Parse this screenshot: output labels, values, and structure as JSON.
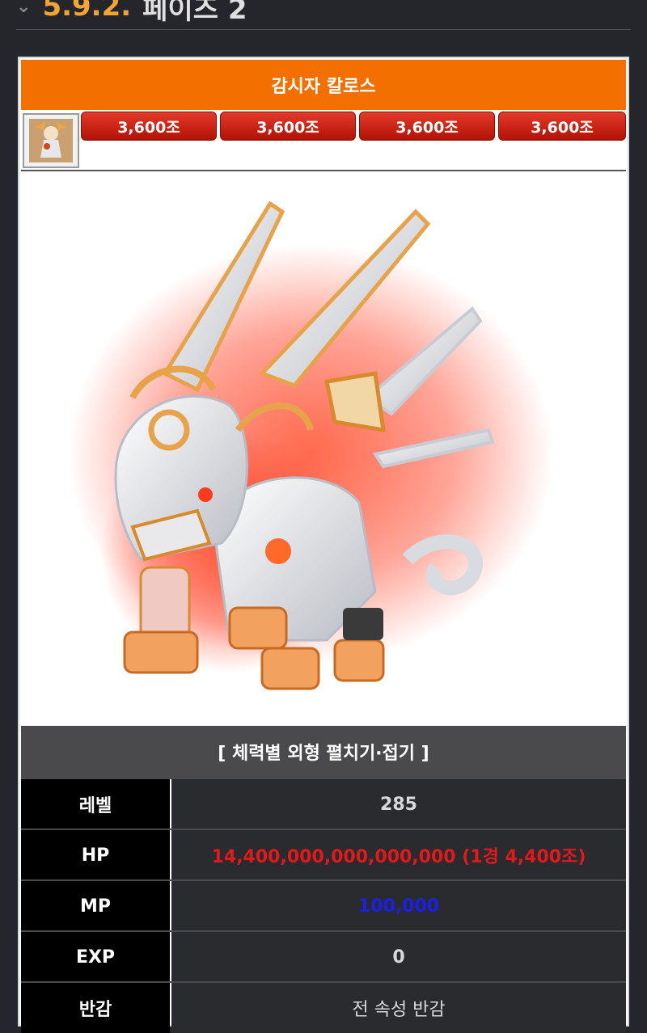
{
  "section": {
    "chevron": "⌄",
    "number": "5.9.2.",
    "title": "페이즈 2"
  },
  "card": {
    "title": "감시자 칼로스",
    "hp_buttons": [
      "3,600조",
      "3,600조",
      "3,600조",
      "3,600조"
    ],
    "stats_header": "[ 체력별 외형 펼치기·접기 ]",
    "stats": [
      {
        "label": "레벨",
        "value": "285",
        "color": "#d8d8d8"
      },
      {
        "label": "HP",
        "value": "14,400,000,000,000,000 (1경 4,400조)",
        "color": "#e0191b"
      },
      {
        "label": "MP",
        "value": "100,000",
        "color": "#1a20e6"
      },
      {
        "label": "EXP",
        "value": "0",
        "color": "#d8d8d8"
      },
      {
        "label": "반감",
        "value": "전 속성 반감",
        "color": "#d8d8d8"
      }
    ]
  },
  "colors": {
    "accent": "#f26f00",
    "hp_button": "#c8200f"
  },
  "icons": {
    "monster_thumb": "kalos-thumbnail-icon",
    "artwork": "kalos-mechanical-lion-artwork"
  }
}
